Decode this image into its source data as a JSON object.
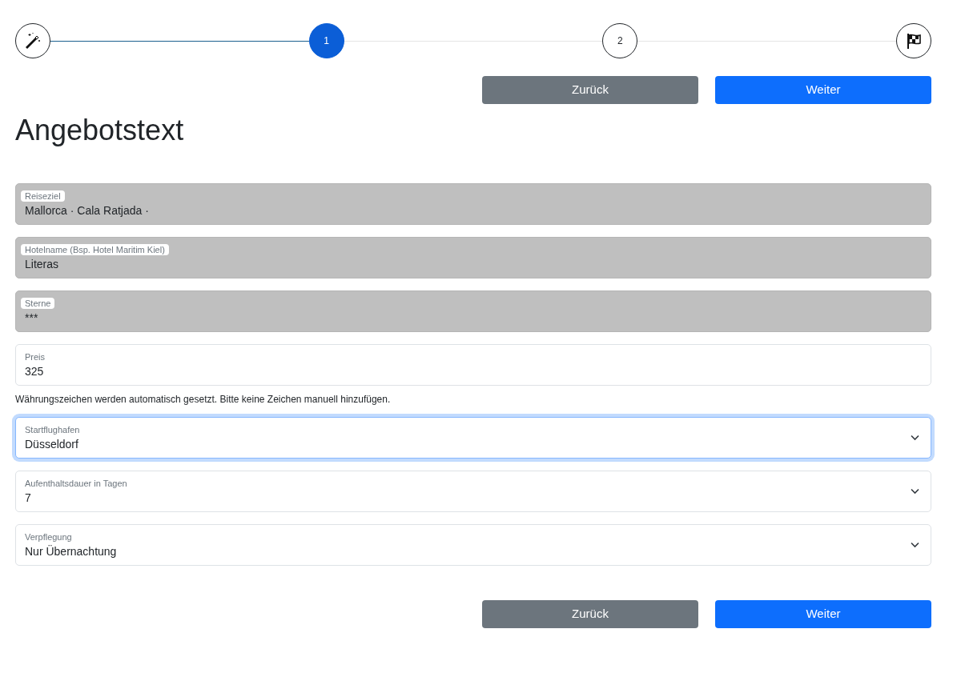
{
  "steps": [
    {
      "kind": "wand",
      "selected": false,
      "completed": true
    },
    {
      "kind": "number",
      "label": "1",
      "selected": true,
      "completed": false
    },
    {
      "kind": "number",
      "label": "2",
      "selected": false,
      "completed": false
    },
    {
      "kind": "flag",
      "selected": false
    }
  ],
  "buttons_top": [
    {
      "kind": "secondary",
      "label": "Zurück"
    },
    {
      "kind": "primary",
      "label": "Weiter"
    }
  ],
  "heading": "Angebotstext",
  "fields": [
    {
      "kind": "input",
      "label": "Reiseziel",
      "value": "Mallorca · Cala Ratjada ·",
      "disabled": true,
      "focused": false
    },
    {
      "kind": "input",
      "label": "Hotelname (Bsp. Hotel Maritim Kiel)",
      "value": "Literas",
      "disabled": true,
      "focused": false
    },
    {
      "kind": "input",
      "label": "Sterne",
      "value": "***",
      "disabled": true,
      "focused": false
    },
    {
      "kind": "input",
      "label": "Preis",
      "value": "325",
      "disabled": false,
      "focused": false,
      "help": "Währungszeichen werden automatisch gesetzt. Bitte keine Zeichen manuell hinzufügen."
    },
    {
      "kind": "select",
      "label": "Startflughafen",
      "value": "Düsseldorf",
      "disabled": false,
      "focused": true
    },
    {
      "kind": "select",
      "label": "Aufenthaltsdauer in Tagen",
      "value": "7",
      "disabled": false,
      "focused": false
    },
    {
      "kind": "select",
      "label": "Verpflegung",
      "value": "Nur Übernachtung",
      "disabled": false,
      "focused": false
    }
  ],
  "buttons_bottom": [
    {
      "kind": "secondary",
      "label": "Zurück"
    },
    {
      "kind": "primary",
      "label": "Weiter"
    }
  ]
}
